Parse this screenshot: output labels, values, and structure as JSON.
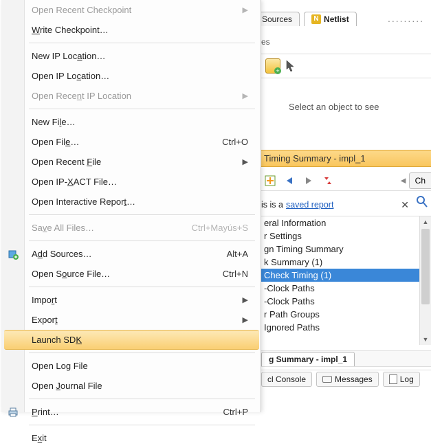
{
  "tabs": {
    "sources_label": "Sources",
    "netlist_label": "Netlist",
    "ellipsis": "........."
  },
  "toolbar_fragment": "es",
  "netlist_placeholder": "Select an object to see",
  "timing_header": "Timing Summary - impl_1",
  "chk_button": "Ch",
  "saved_report": {
    "prefix": "is is a  ",
    "link": "saved report"
  },
  "tree": {
    "items": [
      {
        "label": "eral Information",
        "selected": false
      },
      {
        "label": "r Settings",
        "selected": false
      },
      {
        "label": "gn Timing Summary",
        "selected": false
      },
      {
        "label": "k Summary (1)",
        "selected": false
      },
      {
        "label": "Check Timing (1)",
        "selected": true
      },
      {
        "label": "-Clock Paths",
        "selected": false
      },
      {
        "label": "-Clock Paths",
        "selected": false
      },
      {
        "label": "r Path Groups",
        "selected": false
      },
      {
        "label": "Ignored Paths",
        "selected": false
      }
    ]
  },
  "sub_tab": "g Summary - impl_1",
  "bottom_tabs": {
    "console": "cl Console",
    "messages": "Messages",
    "log": "Log"
  },
  "menu": {
    "open_recent_checkpoint": "Open Recent Checkpoint",
    "write_checkpoint": "Write Checkpoint…",
    "new_ip_location": "New IP Location…",
    "open_ip_location": "Open IP Location…",
    "open_recent_ip_location": "Open Recent IP Location",
    "new_file": "New File…",
    "open_file": "Open File…",
    "open_file_sc": "Ctrl+O",
    "open_recent_file": "Open Recent File",
    "open_ipxact": "Open IP-XACT File…",
    "open_interactive_report": "Open Interactive Report…",
    "save_all": "Save All Files…",
    "save_all_sc": "Ctrl+Mayús+S",
    "add_sources": "Add Sources…",
    "add_sources_sc": "Alt+A",
    "open_source_file": "Open Source File…",
    "open_source_file_sc": "Ctrl+N",
    "import": "Import",
    "export": "Export",
    "launch_sdk": "Launch SDK",
    "open_log": "Open Log File",
    "open_journal": "Open Journal File",
    "print": "Print…",
    "print_sc": "Ctrl+P",
    "exit": "Exit"
  }
}
